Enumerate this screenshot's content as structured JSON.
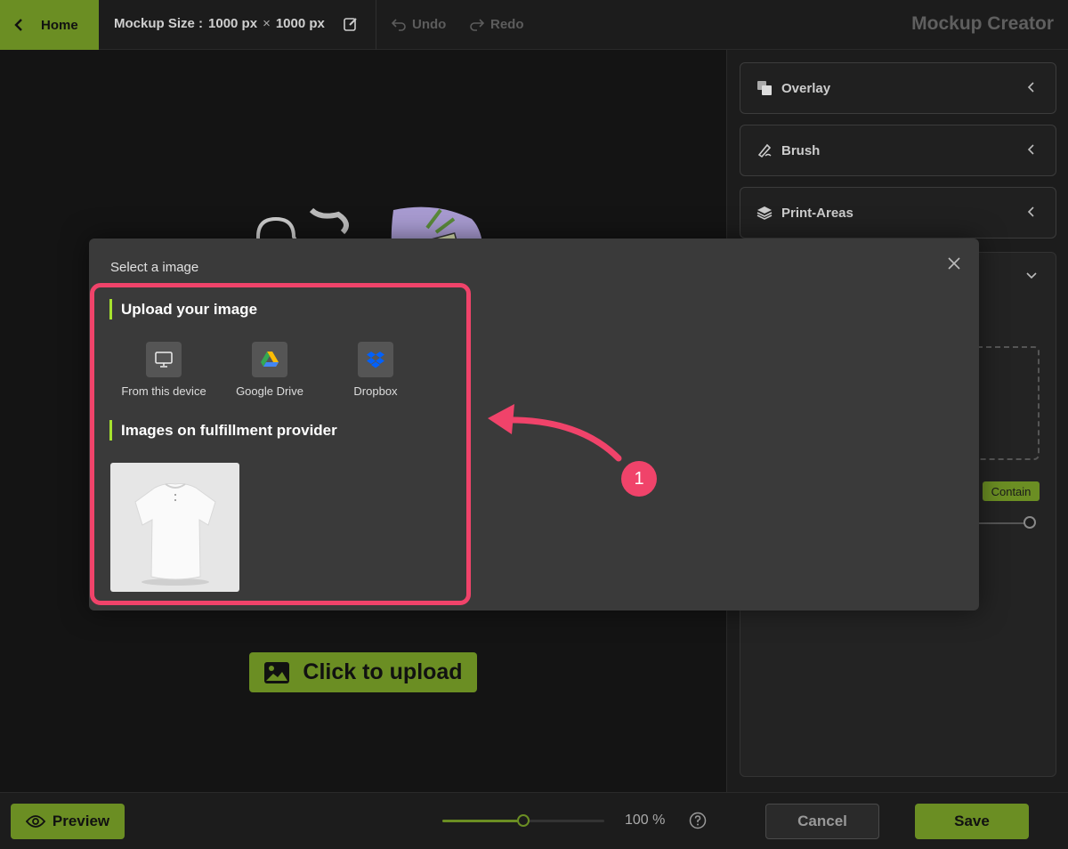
{
  "topbar": {
    "home_label": "Home",
    "mockup_size_label": "Mockup Size :",
    "width": "1000 px",
    "times": "×",
    "height": "1000 px",
    "undo_label": "Undo",
    "redo_label": "Redo",
    "app_title": "Mockup Creator"
  },
  "canvas": {
    "upload_label": "Click to upload"
  },
  "right_panel": {
    "sections": [
      {
        "label": "Overlay",
        "icon": "overlay-icon"
      },
      {
        "label": "Brush",
        "icon": "brush-icon"
      },
      {
        "label": "Print-Areas",
        "icon": "layers-icon"
      }
    ],
    "contain_label": "Contain"
  },
  "bottombar": {
    "preview_label": "Preview",
    "zoom_value": "100 %",
    "zoom_fraction": 0.5,
    "cancel_label": "Cancel",
    "save_label": "Save"
  },
  "modal": {
    "title": "Select a image",
    "upload_heading": "Upload your image",
    "sources": [
      {
        "label": "From this device",
        "icon": "monitor-icon"
      },
      {
        "label": "Google Drive",
        "icon": "google-drive-icon"
      },
      {
        "label": "Dropbox",
        "icon": "dropbox-icon"
      }
    ],
    "provider_heading": "Images on fulfillment provider"
  },
  "annotation": {
    "badge": "1",
    "color": "#f0436a"
  },
  "colors": {
    "accent": "#6b8e23",
    "accent_bright": "#a6e22e"
  }
}
